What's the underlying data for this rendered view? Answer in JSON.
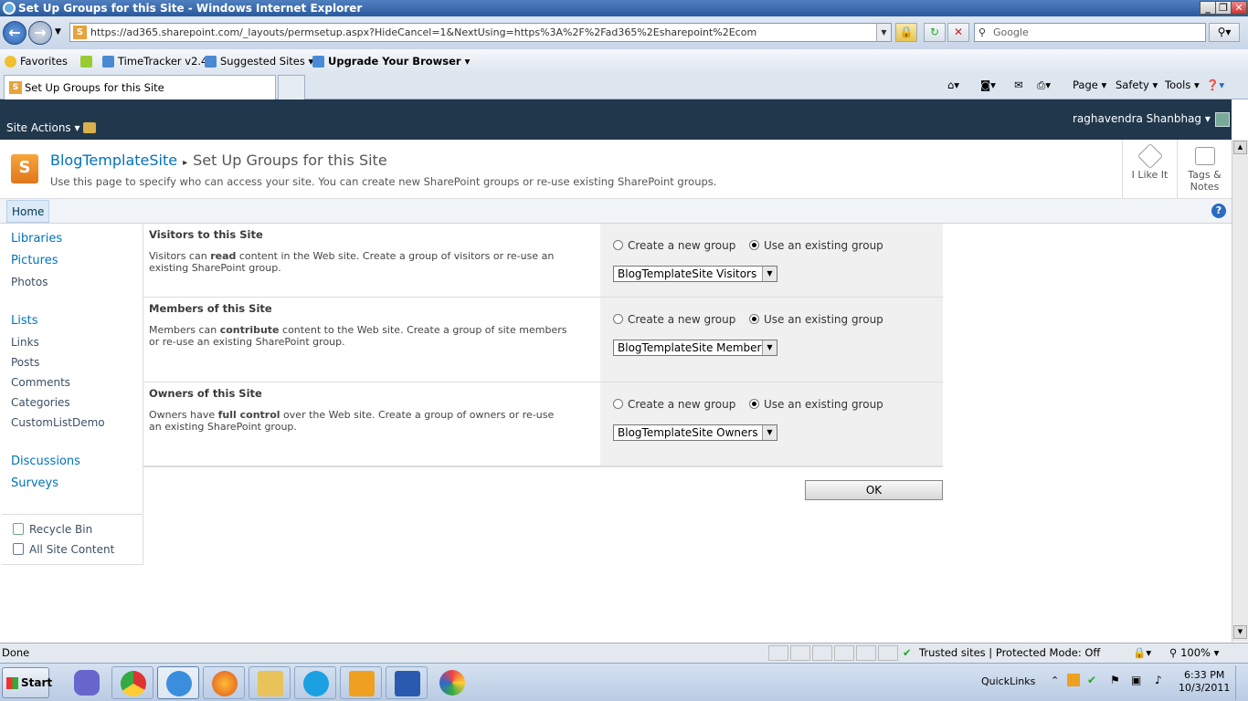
{
  "window": {
    "title": "Set Up Groups for this Site - Windows Internet Explorer"
  },
  "nav": {
    "url": "https://ad365.sharepoint.com/_layouts/permsetup.aspx?HideCancel=1&NextUsing=https%3A%2F%2Fad365%2Esharepoint%2Ecom",
    "search_placeholder": "Google"
  },
  "favorites": {
    "label": "Favorites",
    "items": [
      "TimeTracker v2.4",
      "Suggested Sites",
      "Upgrade Your Browser"
    ]
  },
  "tab": {
    "label": "Set Up Groups for this Site"
  },
  "commandbar": {
    "page": "Page",
    "safety": "Safety",
    "tools": "Tools"
  },
  "ribbon": {
    "site_actions": "Site Actions",
    "user": "raghavendra Shanbhag"
  },
  "titlearea": {
    "site": "BlogTemplateSite",
    "page": "Set Up Groups for this Site",
    "description": "Use this page to specify who can access your site. You can create new SharePoint groups or re-use existing SharePoint groups.",
    "like": "I Like It",
    "tags1": "Tags &",
    "tags2": "Notes"
  },
  "topnav": {
    "home": "Home"
  },
  "quicklaunch": {
    "libraries": "Libraries",
    "pictures": "Pictures",
    "photos": "Photos",
    "lists": "Lists",
    "links": "Links",
    "posts": "Posts",
    "comments": "Comments",
    "categories": "Categories",
    "customlist": "CustomListDemo",
    "discussions": "Discussions",
    "surveys": "Surveys",
    "recycle": "Recycle Bin",
    "allcontent": "All Site Content"
  },
  "form": {
    "create_label": "Create a new group",
    "existing_label": "Use an existing group",
    "visitors": {
      "title": "Visitors to this Site",
      "desc_pre": "Visitors can ",
      "desc_bold": "read",
      "desc_post": " content in the Web site. Create a group of visitors or re-use an existing SharePoint group.",
      "selected": "BlogTemplateSite Visitors"
    },
    "members": {
      "title": "Members of this Site",
      "desc_pre": "Members can ",
      "desc_bold": "contribute",
      "desc_post": " content to the Web site. Create a group of site members or re-use an existing SharePoint group.",
      "selected": "BlogTemplateSite Members"
    },
    "owners": {
      "title": "Owners of this Site",
      "desc_pre": "Owners have ",
      "desc_bold": "full control",
      "desc_post": " over the Web site. Create a group of owners or re-use an existing SharePoint group.",
      "selected": "BlogTemplateSite Owners"
    },
    "ok": "OK"
  },
  "status": {
    "text": "Done",
    "zone": "Trusted sites | Protected Mode: Off",
    "zoom": "100%"
  },
  "taskbar": {
    "start": "Start",
    "quicklinks": "QuickLinks",
    "time": "6:33 PM",
    "date": "10/3/2011"
  }
}
